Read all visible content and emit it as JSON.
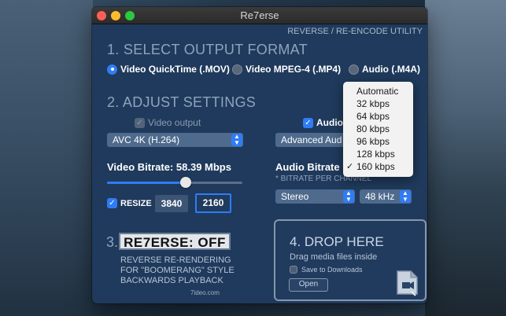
{
  "window": {
    "title": "Re7erse",
    "subtitle": "REVERSE / RE-ENCODE UTILITY"
  },
  "section1": {
    "heading": "1. SELECT OUTPUT FORMAT",
    "options": [
      "Video QuickTime (.MOV)",
      "Video MPEG-4 (.MP4)",
      "Audio (.M4A)"
    ],
    "selected": "Video QuickTime (.MOV)"
  },
  "section2": {
    "heading": "2. ADJUST SETTINGS",
    "video_output_label": "Video output",
    "video_codec": "AVC 4K (H.264)",
    "video_bitrate_label": "Video Bitrate: 58.39 Mbps",
    "video_bitrate_slider_fraction": 0.58,
    "resize_label": "RESIZE",
    "width": "3840",
    "height": "2160",
    "audio_label": "Audio",
    "audio_codec_visible": "Advanced Aud",
    "audio_bitrate_visible": "Audio Bitrate",
    "audio_note_visible": "* BITRATE PER CHANNEL",
    "channels": "Stereo",
    "sample_rate": "48 kHz"
  },
  "bitrate_menu": {
    "items": [
      "Automatic",
      "32 kbps",
      "64 kbps",
      "80 kbps",
      "96 kbps",
      "128 kbps",
      "160 kbps"
    ],
    "checked": "160 kbps",
    "check_glyph": "✓"
  },
  "section3": {
    "number": "3.",
    "button": "RE7ERSE: OFF",
    "description_lines": [
      "REVERSE RE-RENDERING",
      "FOR \"BOOMERANG\" STYLE",
      "BACKWARDS PLAYBACK"
    ],
    "site": "7ideo.com"
  },
  "section4": {
    "heading": "4. DROP HERE",
    "hint": "Drag media files inside",
    "save_label": "Save to Downloads",
    "open_button": "Open"
  },
  "colors": {
    "accent": "#2f7cf6",
    "panel_bg": "#1f3a5c",
    "heading": "#8fa3bd"
  },
  "icons": {
    "arrows": "⌃⌄",
    "check": "✓"
  }
}
